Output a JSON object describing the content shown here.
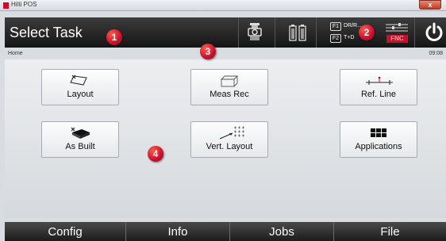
{
  "window": {
    "title": "Hilti POS",
    "close_glyph": "x"
  },
  "header": {
    "title": "Select Task",
    "icons": [
      "instrument-icon",
      "battery-icon"
    ],
    "fkeys": [
      {
        "key": "F1",
        "label": "DR/R..."
      },
      {
        "key": "F2",
        "label": "T+D"
      }
    ],
    "fnc_label": "FNC",
    "power_icon": "power-icon"
  },
  "breadcrumb": {
    "path": "Home",
    "clock": "09:08"
  },
  "tasks": [
    {
      "label": "Layout",
      "icon": "layout-icon"
    },
    {
      "label": "Meas Rec",
      "icon": "meas-rec-icon"
    },
    {
      "label": "Ref. Line",
      "icon": "ref-line-icon"
    },
    {
      "label": "As Built",
      "icon": "as-built-icon"
    },
    {
      "label": "Vert. Layout",
      "icon": "vert-layout-icon"
    },
    {
      "label": "Applications",
      "icon": "applications-icon"
    }
  ],
  "callouts": [
    "1",
    "2",
    "3",
    "4"
  ],
  "bottom_nav": [
    "Config",
    "Info",
    "Jobs",
    "File"
  ],
  "colors": {
    "accent": "#c8102e",
    "header": "#1e1e1e"
  }
}
